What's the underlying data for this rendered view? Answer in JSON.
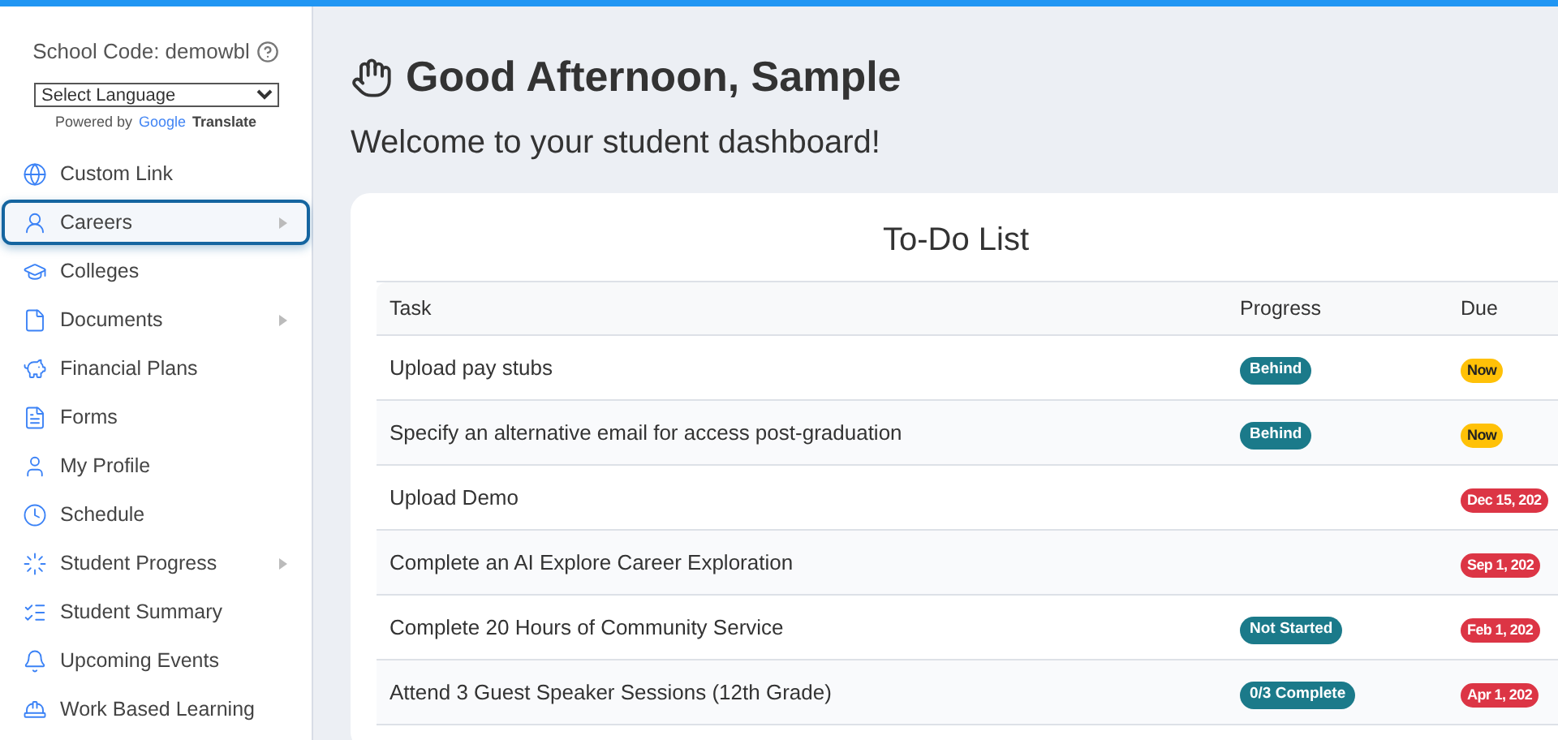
{
  "sidebar": {
    "school_code": "School Code: demowbl",
    "language_select": {
      "value": "Select Language"
    },
    "powered_by": "Powered by",
    "translate_brand": "Google",
    "translate_label": "Translate",
    "items": [
      {
        "label": "Custom Link",
        "has_submenu": false,
        "selected": false
      },
      {
        "label": "Careers",
        "has_submenu": true,
        "selected": true
      },
      {
        "label": "Colleges",
        "has_submenu": false,
        "selected": false
      },
      {
        "label": "Documents",
        "has_submenu": true,
        "selected": false
      },
      {
        "label": "Financial Plans",
        "has_submenu": false,
        "selected": false
      },
      {
        "label": "Forms",
        "has_submenu": false,
        "selected": false
      },
      {
        "label": "My Profile",
        "has_submenu": false,
        "selected": false
      },
      {
        "label": "Schedule",
        "has_submenu": false,
        "selected": false
      },
      {
        "label": "Student Progress",
        "has_submenu": true,
        "selected": false
      },
      {
        "label": "Student Summary",
        "has_submenu": false,
        "selected": false
      },
      {
        "label": "Upcoming Events",
        "has_submenu": false,
        "selected": false
      },
      {
        "label": "Work Based Learning",
        "has_submenu": false,
        "selected": false
      }
    ]
  },
  "greeting": "Good Afternoon, Sample",
  "subtitle": "Welcome to your student dashboard!",
  "todo": {
    "title": "To-Do List",
    "columns": [
      "Task",
      "Progress",
      "Due"
    ],
    "rows": [
      {
        "task": "Upload pay stubs",
        "progress": "Behind",
        "due": "Now",
        "color": "#ffc107"
      },
      {
        "task": "Specify an alternative email for access post-graduation",
        "progress": "Behind",
        "due": "Now",
        "color": "#ffc107"
      },
      {
        "task": "Upload Demo",
        "due": "Dec 15, 202",
        "color": "#dc3545"
      },
      {
        "task": "Complete an AI Explore Career Exploration",
        "due": "Sep 1, 202",
        "color": "#dc3545"
      },
      {
        "task": "Complete 20 Hours of Community Service",
        "progress": "Not Started",
        "due": "Feb 1, 202",
        "color": "#dc3545"
      },
      {
        "task": "Attend 3 Guest Speaker Sessions (12th Grade)",
        "progress": "0/3 Complete",
        "due": "Apr 1, 202",
        "color": "#dc3545"
      }
    ]
  }
}
